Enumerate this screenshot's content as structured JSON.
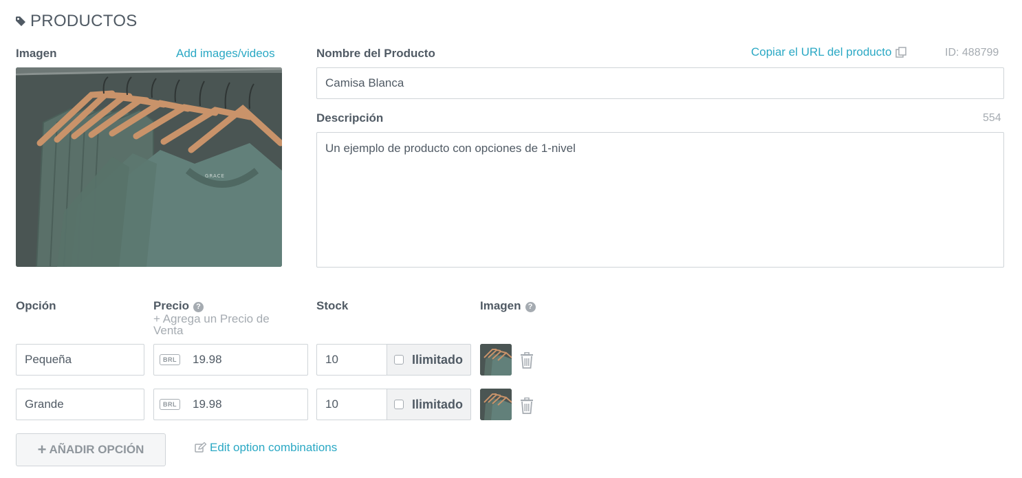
{
  "header": {
    "title": "PRODUCTOS",
    "icon": "tag-icon"
  },
  "image_section": {
    "label": "Imagen",
    "add_link": "Add images/videos"
  },
  "product": {
    "name_label": "Nombre del Producto",
    "copy_url_link": "Copiar el URL del producto",
    "id_text": "ID: 488799",
    "name_value": "Camisa Blanca",
    "description_label": "Descripción",
    "description_count": "554",
    "description_value": "Un ejemplo de producto con opciones de 1-nivel"
  },
  "options": {
    "headers": {
      "option": "Opción",
      "price": "Precio",
      "add_sale_price": "+ Agrega un Precio de Venta",
      "stock": "Stock",
      "image": "Imagen"
    },
    "currency": "BRL",
    "unlimited_label": "Ilimitado",
    "rows": [
      {
        "name": "Pequeña",
        "price": "19.98",
        "stock": "10",
        "unlimited": false
      },
      {
        "name": "Grande",
        "price": "19.98",
        "stock": "10",
        "unlimited": false
      }
    ],
    "add_button": "AÑADIR OPCIÓN",
    "edit_link": "Edit option combinations"
  },
  "colors": {
    "accent": "#2aa8c4",
    "text": "#505a64",
    "muted": "#a5abb1",
    "shirt": "#5f7a73"
  }
}
